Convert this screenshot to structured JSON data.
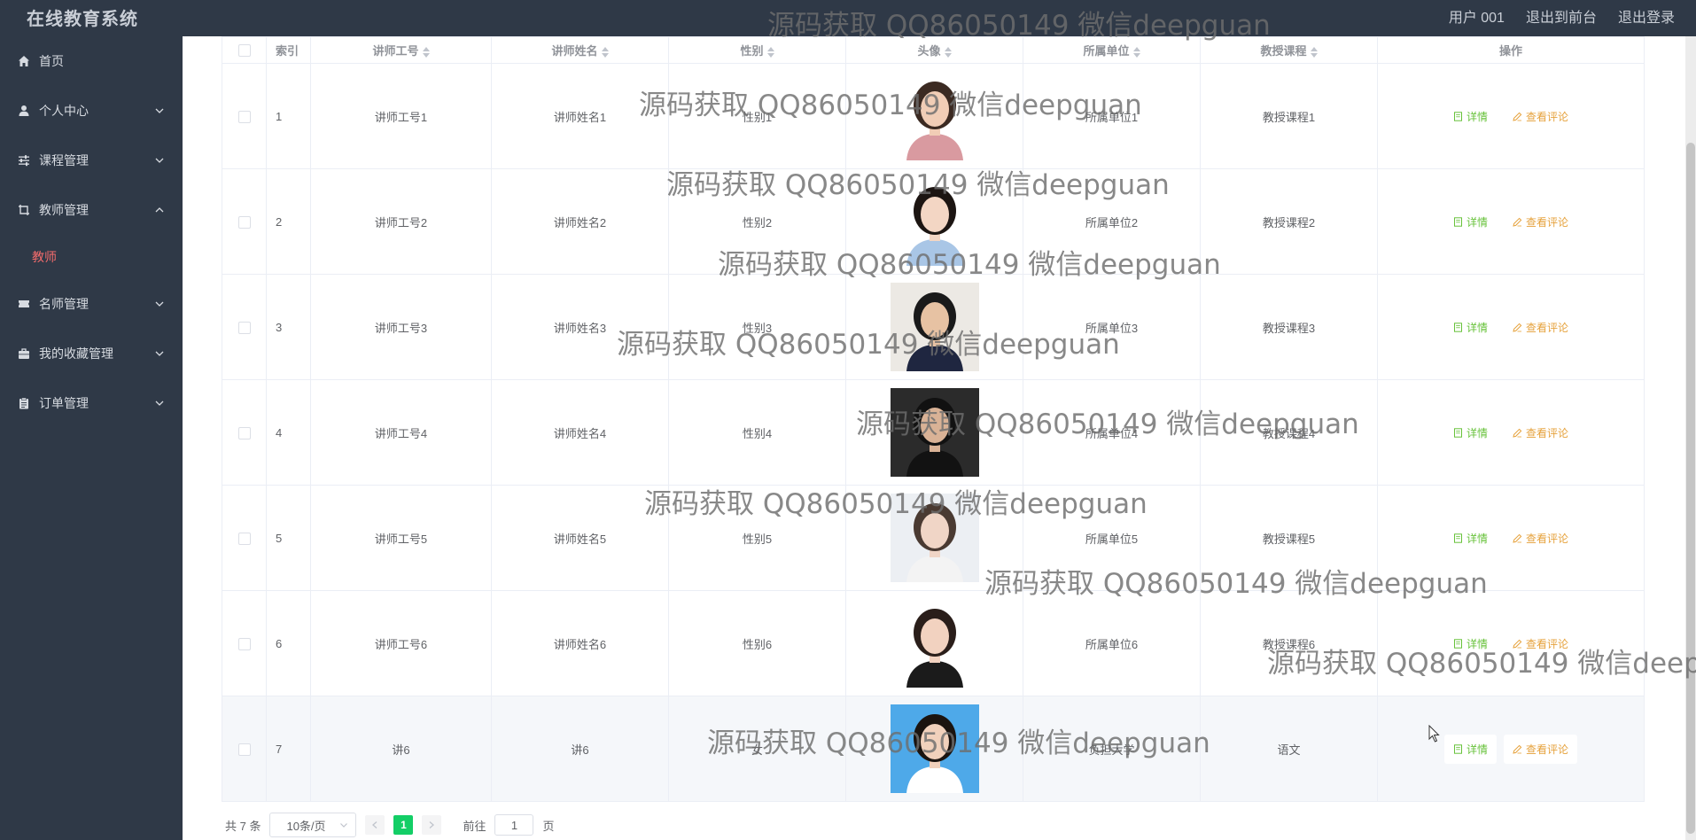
{
  "header": {
    "brand": "在线教育系统",
    "user": "用户 001",
    "to_front": "退出到前台",
    "logout": "退出登录"
  },
  "sidebar": {
    "items": [
      {
        "label": "首页",
        "icon": "home-icon"
      },
      {
        "label": "个人中心",
        "icon": "user-icon"
      },
      {
        "label": "课程管理",
        "icon": "sliders-icon"
      },
      {
        "label": "教师管理",
        "icon": "crop-icon"
      },
      {
        "label": "名师管理",
        "icon": "ticket-icon"
      },
      {
        "label": "我的收藏管理",
        "icon": "briefcase-icon"
      },
      {
        "label": "订单管理",
        "icon": "clipboard-icon"
      }
    ],
    "submenu_active": "教师"
  },
  "table": {
    "columns": [
      "索引",
      "讲师工号",
      "讲师姓名",
      "性别",
      "头像",
      "所属单位",
      "教授课程",
      "操作"
    ],
    "detail_label": "详情",
    "review_label": "查看评论",
    "rows": [
      {
        "index": "1",
        "code": "讲师工号1",
        "name": "讲师姓名1",
        "gender": "性别1",
        "unit": "所属单位1",
        "course": "教授课程1"
      },
      {
        "index": "2",
        "code": "讲师工号2",
        "name": "讲师姓名2",
        "gender": "性别2",
        "unit": "所属单位2",
        "course": "教授课程2"
      },
      {
        "index": "3",
        "code": "讲师工号3",
        "name": "讲师姓名3",
        "gender": "性别3",
        "unit": "所属单位3",
        "course": "教授课程3"
      },
      {
        "index": "4",
        "code": "讲师工号4",
        "name": "讲师姓名4",
        "gender": "性别4",
        "unit": "所属单位4",
        "course": "教授课程4"
      },
      {
        "index": "5",
        "code": "讲师工号5",
        "name": "讲师姓名5",
        "gender": "性别5",
        "unit": "所属单位5",
        "course": "教授课程5"
      },
      {
        "index": "6",
        "code": "讲师工号6",
        "name": "讲师姓名6",
        "gender": "性别6",
        "unit": "所属单位6",
        "course": "教授课程6"
      },
      {
        "index": "7",
        "code": "讲6",
        "name": "讲6",
        "gender": "女",
        "unit": "负担大学",
        "course": "语文"
      }
    ]
  },
  "pagination": {
    "total": "共 7 条",
    "page_size": "10条/页",
    "current_page": "1",
    "goto_prefix": "前往",
    "goto_value": "1",
    "goto_suffix": "页"
  },
  "watermark": "源码获取 QQ86050149 微信deepguan"
}
